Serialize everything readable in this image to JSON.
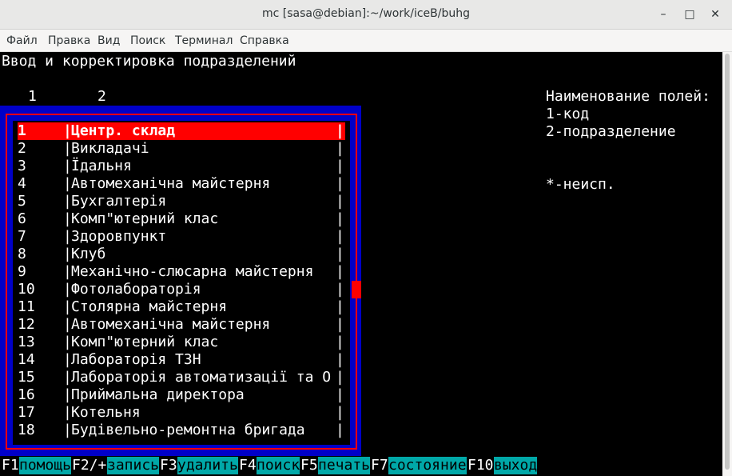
{
  "window": {
    "title": "mc [sasa@debian]:~/work/iceB/buhg",
    "minimize": "–",
    "maximize": "□",
    "close": "✕"
  },
  "menu": [
    "Файл",
    "Правка",
    "Вид",
    "Поиск",
    "Терминал",
    "Справка"
  ],
  "screen": {
    "heading": "Ввод и корректировка подразделений",
    "col_numbers": [
      "1",
      "2"
    ],
    "legend": {
      "title": "Наименование полей:",
      "items": [
        "1-код",
        "2-подразделение"
      ],
      "note": "*-неисп."
    }
  },
  "rows": [
    {
      "code": "1",
      "name": "Центр. склад"
    },
    {
      "code": "2",
      "name": "Викладачі"
    },
    {
      "code": "3",
      "name": "Їдальня"
    },
    {
      "code": "4",
      "name": "Автомеханічна майстерня"
    },
    {
      "code": "5",
      "name": "Бухгалтерія"
    },
    {
      "code": "6",
      "name": "Комп\"ютерний клас"
    },
    {
      "code": "7",
      "name": "Здоровпункт"
    },
    {
      "code": "8",
      "name": "Клуб"
    },
    {
      "code": "9",
      "name": "Механічно-слюсарна майстерня"
    },
    {
      "code": "10",
      "name": "Фотолабораторія"
    },
    {
      "code": "11",
      "name": "Столярна майстерня"
    },
    {
      "code": "12",
      "name": "Автомеханічна майстерня"
    },
    {
      "code": "13",
      "name": "Комп\"ютерний клас"
    },
    {
      "code": "14",
      "name": "Лабораторія ТЗН"
    },
    {
      "code": "15",
      "name": "Лабораторія автоматизації та О"
    },
    {
      "code": "16",
      "name": "Приймальна директора"
    },
    {
      "code": "17",
      "name": "Котельня"
    },
    {
      "code": "18",
      "name": "Будівельно-ремонтна бригада"
    }
  ],
  "selected_index": 0,
  "separator": "|",
  "fkeys": [
    {
      "key": "F1",
      "label": "помощь"
    },
    {
      "key": "F2/+",
      "label": "запись"
    },
    {
      "key": "F3",
      "label": "удалить"
    },
    {
      "key": "F4",
      "label": "поиск"
    },
    {
      "key": "F5",
      "label": "печать"
    },
    {
      "key": "F7",
      "label": "состояние"
    },
    {
      "key": "F10",
      "label": "выход"
    }
  ],
  "colors": {
    "terminal_bg": "#000000",
    "frame_blue": "#0000c8",
    "highlight_red": "#ff0000",
    "fkey_label_bg": "#00a8a8"
  }
}
